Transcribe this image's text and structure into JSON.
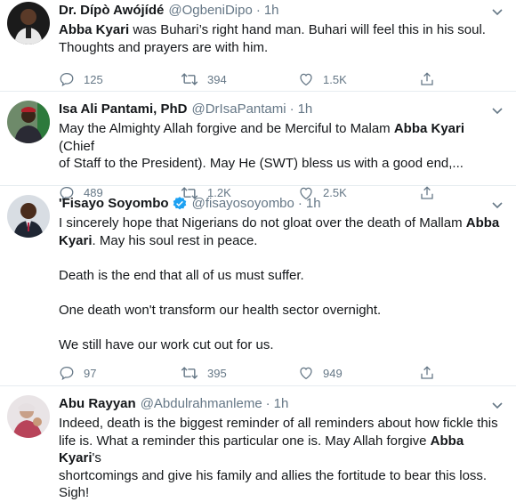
{
  "tweets": [
    {
      "name": "Dr. Dípò Awójídé",
      "handle": "@OgbeniDipo",
      "time": "1h",
      "verified": false,
      "body": [
        {
          "t": "Abba Kyari",
          "b": true
        },
        {
          "t": " was Buhari’s right hand man. Buhari will feel this in his soul.\nThoughts and prayers are with him.",
          "b": false
        }
      ],
      "replies": "125",
      "retweets": "394",
      "likes": "1.5K"
    },
    {
      "name": "Isa Ali Pantami, PhD",
      "handle": "@DrIsaPantami",
      "time": "1h",
      "verified": false,
      "body": [
        {
          "t": "May the Almighty Allah forgive and be Merciful to Malam ",
          "b": false
        },
        {
          "t": "Abba Kyari",
          "b": true
        },
        {
          "t": " (Chief\nof Staff to the President). May He (SWT) bless us with a good end,...",
          "b": false
        }
      ],
      "replies": "489",
      "retweets": "1.2K",
      "likes": "2.5K"
    },
    {
      "name": "'Fisayo Soyombo",
      "handle": "@fisayosoyombo",
      "time": "1h",
      "verified": true,
      "body": [
        {
          "t": "I sincerely hope that Nigerians do not gloat over the death of Mallam ",
          "b": false
        },
        {
          "t": "Abba\nKyari",
          "b": true
        },
        {
          "t": ". May his soul rest in peace.\n\nDeath is the end that all of us must suffer.\n\nOne death won't transform our health sector overnight.\n\nWe still have our work cut out for us.",
          "b": false
        }
      ],
      "replies": "97",
      "retweets": "395",
      "likes": "949"
    },
    {
      "name": "Abu Rayyan",
      "handle": "@Abdulrahmanleme",
      "time": "1h",
      "verified": false,
      "body": [
        {
          "t": "Indeed, death is the biggest reminder of all reminders about how fickle this\nlife is. What a reminder this particular one is. May Allah forgive ",
          "b": false
        },
        {
          "t": "Abba Kyari",
          "b": true
        },
        {
          "t": "'s\nshortcomings and give his family and allies the fortitude to bear this loss.\nSigh!",
          "b": false
        }
      ],
      "replies": "",
      "retweets": "",
      "likes": ""
    }
  ],
  "colors": {
    "text": "#14171a",
    "secondary": "#657786",
    "verified": "#1da1f2",
    "divider": "#e6ecf0"
  },
  "icons": [
    "reply-icon",
    "retweet-icon",
    "like-icon",
    "share-icon",
    "verified-badge-icon",
    "chevron-down-icon"
  ]
}
